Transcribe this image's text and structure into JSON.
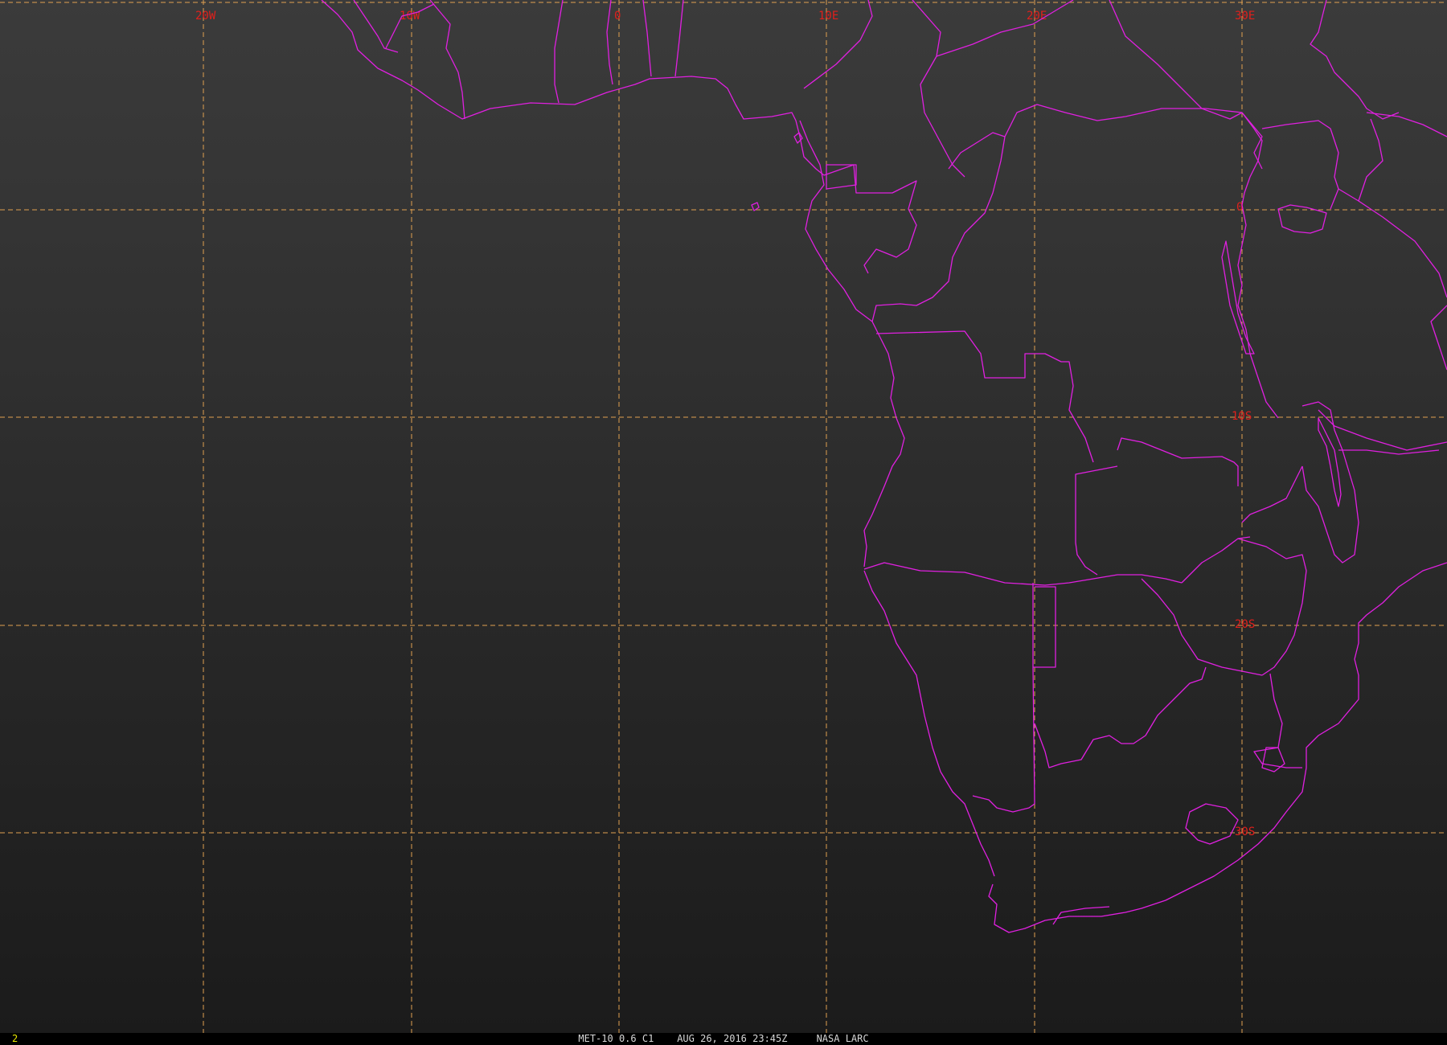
{
  "grid": {
    "longitude_labels": [
      "20W",
      "10W",
      "0",
      "10E",
      "20E",
      "30E"
    ],
    "latitude_labels": [
      "0",
      "10S",
      "20S",
      "30S"
    ]
  },
  "colors": {
    "background_top": "#3a3a3a",
    "background_bottom": "#1a1a1a",
    "gridline": "#e0a050",
    "coastline": "#e020e0",
    "label": "#e0201c"
  },
  "footer": {
    "frame_number": "2",
    "caption": "MET-10 0.6 C1    AUG 26, 2016 23:45Z     NASA LARC"
  }
}
